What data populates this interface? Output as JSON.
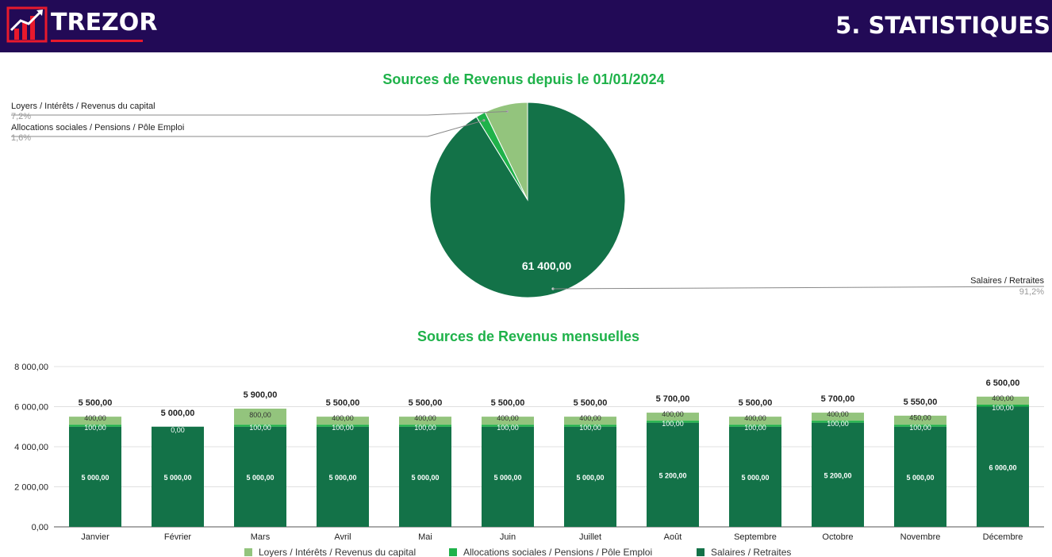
{
  "header": {
    "logo_text": "TREZOR",
    "page_title": "5. STATISTIQUES"
  },
  "colors": {
    "header_bg": "#220a56",
    "loyers": "#93c47d",
    "allocations": "#1fb24a",
    "salaires": "#137248",
    "title_green": "#1fb24a",
    "logo_red": "#e8192c"
  },
  "chart_data": [
    {
      "type": "pie",
      "title": "Sources de Revenus depuis le 01/01/2024",
      "slices": [
        {
          "name": "Loyers / Intérêts / Revenus du capital",
          "percent_label": "7,2%",
          "percent": 7.2
        },
        {
          "name": "Allocations sociales / Pensions / Pôle Emploi",
          "percent_label": "1,6%",
          "percent": 1.6
        },
        {
          "name": "Salaires / Retraites",
          "percent_label": "91,2%",
          "percent": 91.2,
          "value_label": "61 400,00"
        }
      ]
    },
    {
      "type": "bar",
      "stacked": true,
      "title": "Sources de Revenus mensuelles",
      "categories": [
        "Janvier",
        "Février",
        "Mars",
        "Avril",
        "Mai",
        "Juin",
        "Juillet",
        "Août",
        "Septembre",
        "Octobre",
        "Novembre",
        "Décembre"
      ],
      "ylim": [
        0,
        8000
      ],
      "yticks": [
        "0,00",
        "2 000,00",
        "4 000,00",
        "6 000,00",
        "8 000,00"
      ],
      "series": [
        {
          "name": "Salaires / Retraites",
          "values": [
            5000,
            5000,
            5000,
            5000,
            5000,
            5000,
            5000,
            5200,
            5000,
            5200,
            5000,
            6000
          ],
          "labels": [
            "5 000,00",
            "5 000,00",
            "5 000,00",
            "5 000,00",
            "5 000,00",
            "5 000,00",
            "5 000,00",
            "5 200,00",
            "5 000,00",
            "5 200,00",
            "5 000,00",
            "6 000,00"
          ]
        },
        {
          "name": "Allocations sociales / Pensions / Pôle Emploi",
          "values": [
            100,
            0,
            100,
            100,
            100,
            100,
            100,
            100,
            100,
            100,
            100,
            100
          ],
          "labels": [
            "100,00",
            "0,00",
            "100,00",
            "100,00",
            "100,00",
            "100,00",
            "100,00",
            "100,00",
            "100,00",
            "100,00",
            "100,00",
            "100,00"
          ]
        },
        {
          "name": "Loyers / Intérêts / Revenus du capital",
          "values": [
            400,
            0,
            800,
            400,
            400,
            400,
            400,
            400,
            400,
            400,
            450,
            400
          ],
          "labels": [
            "400,00",
            "",
            "800,00",
            "400,00",
            "400,00",
            "400,00",
            "400,00",
            "400,00",
            "400,00",
            "400,00",
            "450,00",
            "400,00"
          ]
        }
      ],
      "totals": [
        "5 500,00",
        "5 000,00",
        "5 900,00",
        "5 500,00",
        "5 500,00",
        "5 500,00",
        "5 500,00",
        "5 700,00",
        "5 500,00",
        "5 700,00",
        "5 550,00",
        "6 500,00"
      ],
      "legend": [
        "Loyers / Intérêts / Revenus du capital",
        "Allocations sociales / Pensions / Pôle Emploi",
        "Salaires / Retraites"
      ],
      "legend_position": "bottom",
      "grid": true
    }
  ]
}
